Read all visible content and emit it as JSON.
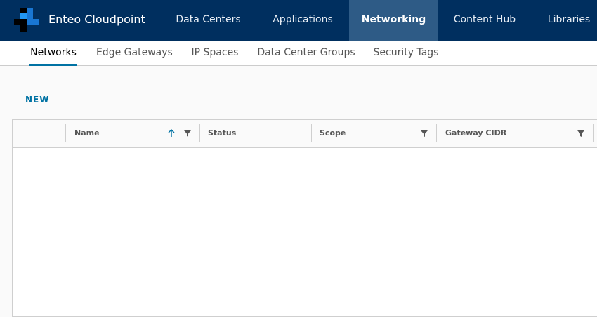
{
  "app": {
    "title": "Enteo Cloudpoint"
  },
  "topnav": {
    "items": [
      {
        "label": "Data Centers"
      },
      {
        "label": "Applications"
      },
      {
        "label": "Networking",
        "active": true
      },
      {
        "label": "Content Hub"
      },
      {
        "label": "Libraries"
      }
    ]
  },
  "subnav": {
    "tabs": [
      {
        "label": "Networks",
        "active": true
      },
      {
        "label": "Edge Gateways"
      },
      {
        "label": "IP Spaces"
      },
      {
        "label": "Data Center Groups"
      },
      {
        "label": "Security Tags"
      }
    ]
  },
  "toolbar": {
    "new_label": "NEW"
  },
  "grid": {
    "columns": [
      {
        "label": "Name",
        "sort": "ascending",
        "filter": true
      },
      {
        "label": "Status",
        "filter": false
      },
      {
        "label": "Scope",
        "filter": true
      },
      {
        "label": "Gateway CIDR",
        "filter": true
      }
    ],
    "rows": []
  },
  "colors": {
    "header_bg": "#002f5f",
    "active_nav_bg": "#2e5b86",
    "accent": "#0072a3",
    "logo_blue": "#1976d2"
  },
  "icons": [
    "brand-logo",
    "sort-ascending-icon",
    "filter-icon"
  ]
}
